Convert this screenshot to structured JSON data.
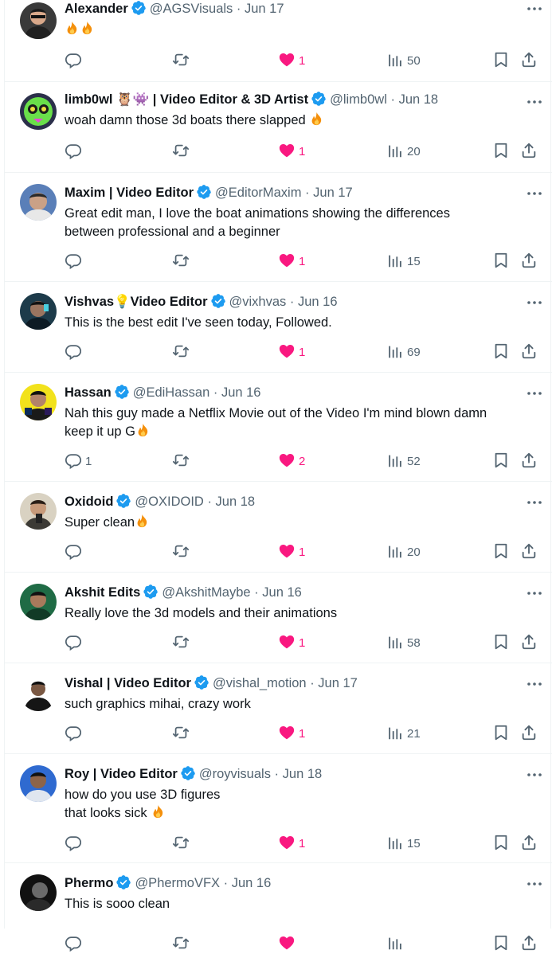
{
  "colors": {
    "accent": "#1d9bf0",
    "like": "#f91880",
    "muted": "#536471",
    "text": "#0f1419",
    "border": "#eff3f4"
  },
  "icons": {
    "reply": "reply-icon",
    "retweet": "retweet-icon",
    "like": "heart-filled-icon",
    "views": "views-icon",
    "bookmark": "bookmark-icon",
    "share": "share-icon",
    "more": "more-icon",
    "verified": "verified-badge-icon",
    "fire": "fire-emoji"
  },
  "tweets": [
    {
      "name": "Alexander",
      "handle": "@AGSVisuals",
      "sep": "·",
      "date": "Jun 17",
      "text": "",
      "replies": "",
      "likes": "1",
      "views": "50"
    },
    {
      "name": "limb0wl",
      "name_suffix": "| Video Editor & 3D Artist",
      "handle": "@limb0wl",
      "sep": "·",
      "date": "Jun 18",
      "text": "woah damn those 3d boats there slapped",
      "replies": "",
      "likes": "1",
      "views": "20"
    },
    {
      "name": "Maxim | Video Editor",
      "handle": "@EditorMaxim",
      "sep": "·",
      "date": "Jun 17",
      "text": "Great edit man, I love the boat animations showing the differences\nbetween professional and a beginner",
      "replies": "",
      "likes": "1",
      "views": "15"
    },
    {
      "name": "Vishvas",
      "name_suffix": "Video Editor",
      "handle": "@vixhvas",
      "sep": "·",
      "date": "Jun 16",
      "text": "This is the best edit I've seen today, Followed.",
      "replies": "",
      "likes": "1",
      "views": "69"
    },
    {
      "name": "Hassan",
      "handle": "@EdiHassan",
      "sep": "·",
      "date": "Jun 16",
      "text": "Nah this guy made a Netflix Movie out of the Video I'm mind blown damn\nkeep it up G",
      "replies": "1",
      "likes": "2",
      "views": "52"
    },
    {
      "name": "Oxidoid",
      "handle": "@OXIDOID",
      "sep": "·",
      "date": "Jun 18",
      "text": "Super clean",
      "replies": "",
      "likes": "1",
      "views": "20"
    },
    {
      "name": "Akshit Edits",
      "handle": "@AkshitMaybe",
      "sep": "·",
      "date": "Jun 16",
      "text": "Really love the 3d models and their animations",
      "replies": "",
      "likes": "1",
      "views": "58"
    },
    {
      "name": "Vishal | Video Editor",
      "handle": "@vishal_motion",
      "sep": "·",
      "date": "Jun 17",
      "text": "such graphics mihai, crazy work",
      "replies": "",
      "likes": "1",
      "views": "21"
    },
    {
      "name": "Roy | Video Editor",
      "handle": "@royvisuals",
      "sep": "·",
      "date": "Jun 18",
      "text": "how do you use 3D figures\nthat looks sick",
      "replies": "",
      "likes": "1",
      "views": "15"
    },
    {
      "name": "Phermo",
      "handle": "@PhermoVFX",
      "sep": "·",
      "date": "Jun 16",
      "text": "This is sooo clean",
      "replies": "",
      "likes": "",
      "views": ""
    }
  ]
}
